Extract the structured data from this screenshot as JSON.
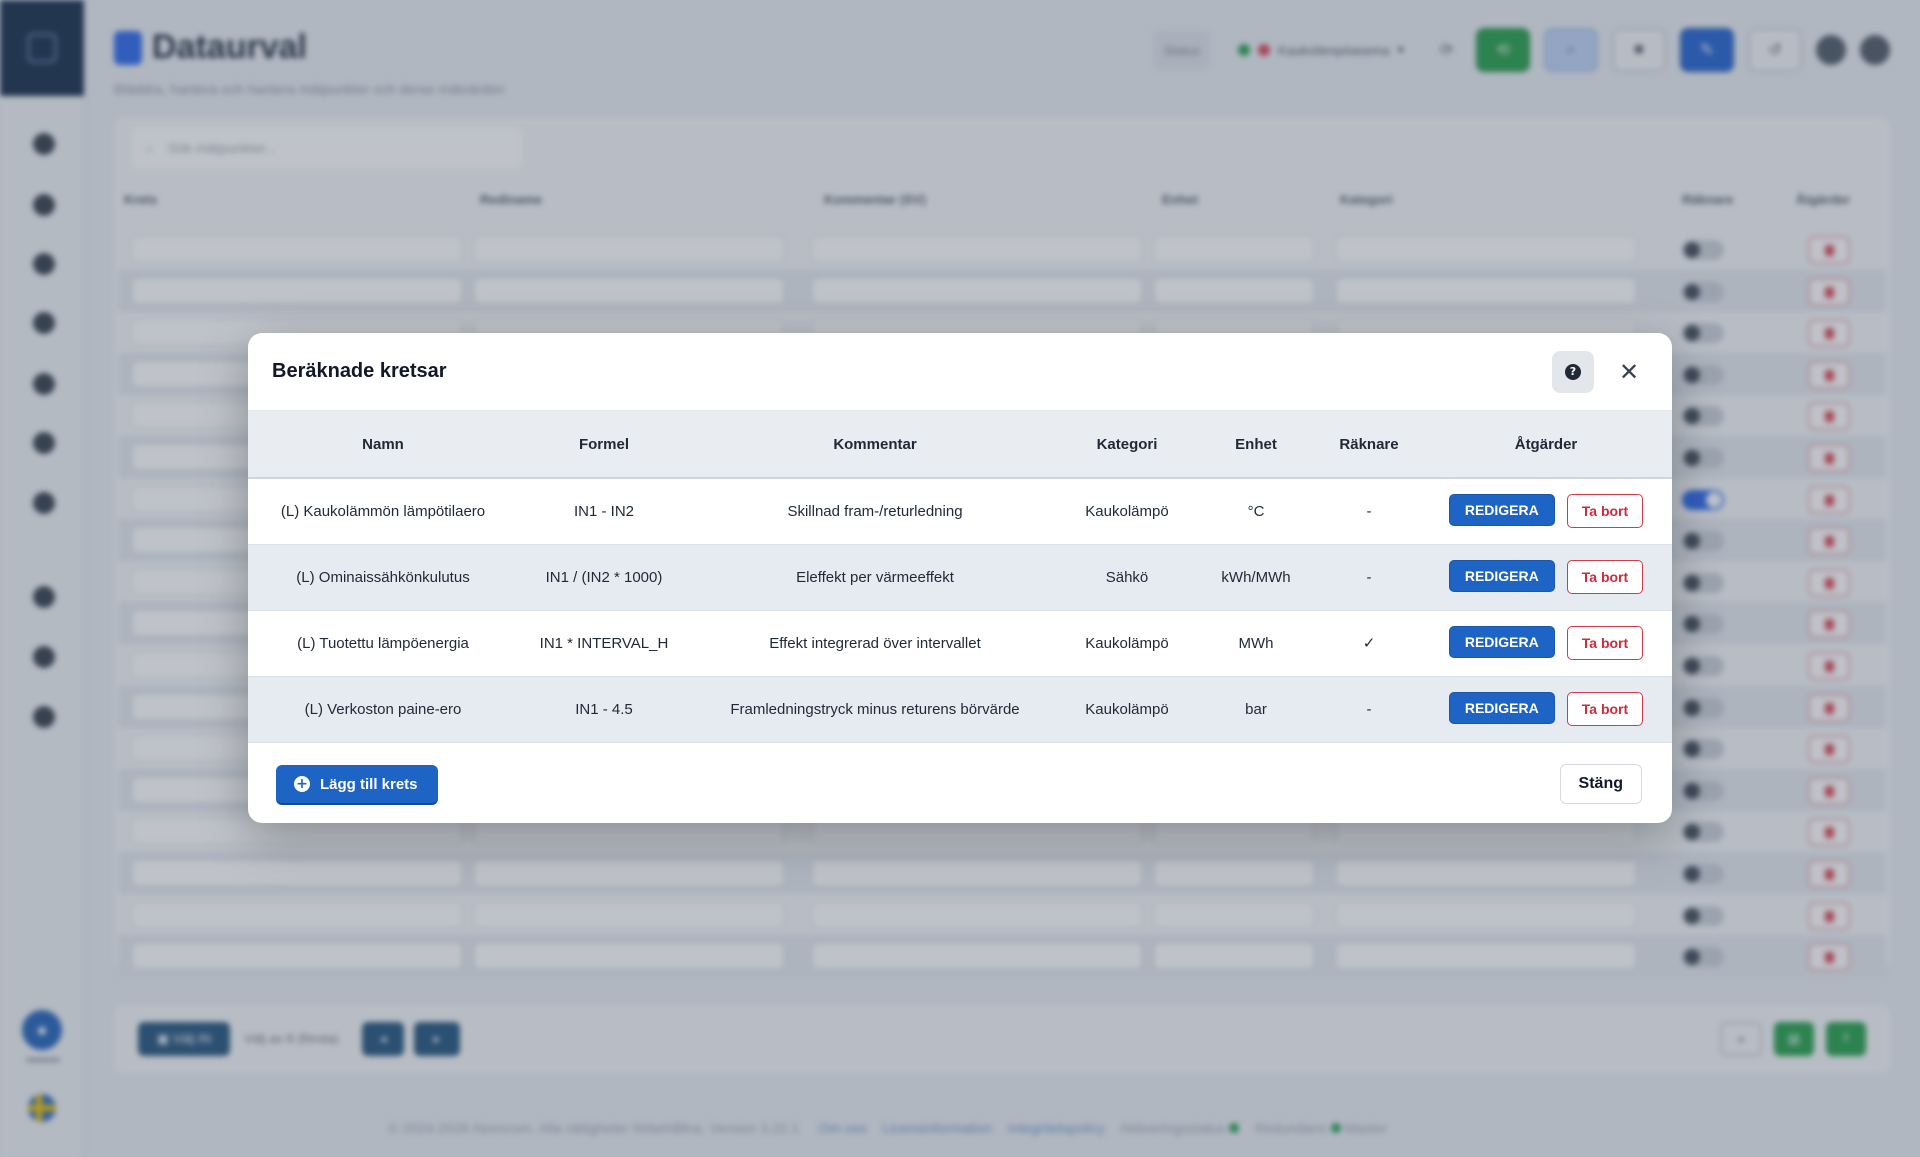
{
  "modal": {
    "title": "Beräknade kretsar",
    "columns": [
      "Namn",
      "Formel",
      "Kommentar",
      "Kategori",
      "Enhet",
      "Räknare",
      "Åtgärder"
    ],
    "rows": [
      {
        "name": "(L) Kaukolämmön lämpötilaero",
        "formula": "IN1 - IN2",
        "comment": "Skillnad fram-/returledning",
        "category": "Kaukolämpö",
        "unit": "°C",
        "counter": "-"
      },
      {
        "name": "(L) Ominaissähkönkulutus",
        "formula": "IN1 / (IN2 * 1000)",
        "comment": "Eleffekt per värmeeffekt",
        "category": "Sähkö",
        "unit": "kWh/MWh",
        "counter": "-"
      },
      {
        "name": "(L) Tuotettu lämpöenergia",
        "formula": "IN1 * INTERVAL_H",
        "comment": "Effekt integrerad över intervallet",
        "category": "Kaukolämpö",
        "unit": "MWh",
        "counter": "✓"
      },
      {
        "name": "(L) Verkoston paine-ero",
        "formula": "IN1 - 4.5",
        "comment": "Framledningstryck minus returens börvärde",
        "category": "Kaukolämpö",
        "unit": "bar",
        "counter": "-"
      }
    ],
    "edit_label": "REDIGERA",
    "delete_label": "Ta bort",
    "add_label": "Lägg till krets",
    "close_label": "Stäng"
  },
  "background": {
    "page_title": "Dataurval",
    "colors": {
      "accent": "#1d64c4",
      "danger": "#c62e3e",
      "sidebar_dark": "#0f2744",
      "success": "#1f9d46"
    }
  }
}
